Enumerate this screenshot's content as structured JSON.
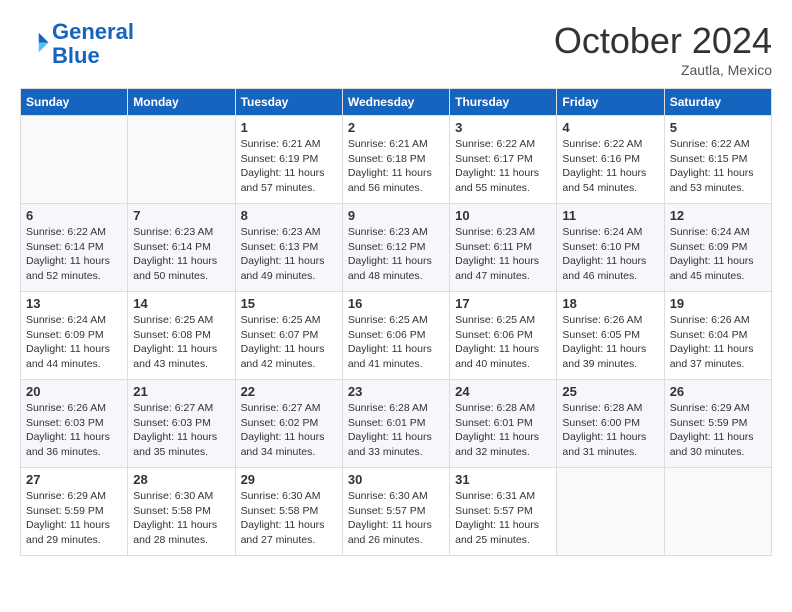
{
  "header": {
    "logo_line1": "General",
    "logo_line2": "Blue",
    "month": "October 2024",
    "location": "Zautla, Mexico"
  },
  "weekdays": [
    "Sunday",
    "Monday",
    "Tuesday",
    "Wednesday",
    "Thursday",
    "Friday",
    "Saturday"
  ],
  "weeks": [
    [
      {
        "day": "",
        "info": ""
      },
      {
        "day": "",
        "info": ""
      },
      {
        "day": "1",
        "info": "Sunrise: 6:21 AM\nSunset: 6:19 PM\nDaylight: 11 hours and 57 minutes."
      },
      {
        "day": "2",
        "info": "Sunrise: 6:21 AM\nSunset: 6:18 PM\nDaylight: 11 hours and 56 minutes."
      },
      {
        "day": "3",
        "info": "Sunrise: 6:22 AM\nSunset: 6:17 PM\nDaylight: 11 hours and 55 minutes."
      },
      {
        "day": "4",
        "info": "Sunrise: 6:22 AM\nSunset: 6:16 PM\nDaylight: 11 hours and 54 minutes."
      },
      {
        "day": "5",
        "info": "Sunrise: 6:22 AM\nSunset: 6:15 PM\nDaylight: 11 hours and 53 minutes."
      }
    ],
    [
      {
        "day": "6",
        "info": "Sunrise: 6:22 AM\nSunset: 6:14 PM\nDaylight: 11 hours and 52 minutes."
      },
      {
        "day": "7",
        "info": "Sunrise: 6:23 AM\nSunset: 6:14 PM\nDaylight: 11 hours and 50 minutes."
      },
      {
        "day": "8",
        "info": "Sunrise: 6:23 AM\nSunset: 6:13 PM\nDaylight: 11 hours and 49 minutes."
      },
      {
        "day": "9",
        "info": "Sunrise: 6:23 AM\nSunset: 6:12 PM\nDaylight: 11 hours and 48 minutes."
      },
      {
        "day": "10",
        "info": "Sunrise: 6:23 AM\nSunset: 6:11 PM\nDaylight: 11 hours and 47 minutes."
      },
      {
        "day": "11",
        "info": "Sunrise: 6:24 AM\nSunset: 6:10 PM\nDaylight: 11 hours and 46 minutes."
      },
      {
        "day": "12",
        "info": "Sunrise: 6:24 AM\nSunset: 6:09 PM\nDaylight: 11 hours and 45 minutes."
      }
    ],
    [
      {
        "day": "13",
        "info": "Sunrise: 6:24 AM\nSunset: 6:09 PM\nDaylight: 11 hours and 44 minutes."
      },
      {
        "day": "14",
        "info": "Sunrise: 6:25 AM\nSunset: 6:08 PM\nDaylight: 11 hours and 43 minutes."
      },
      {
        "day": "15",
        "info": "Sunrise: 6:25 AM\nSunset: 6:07 PM\nDaylight: 11 hours and 42 minutes."
      },
      {
        "day": "16",
        "info": "Sunrise: 6:25 AM\nSunset: 6:06 PM\nDaylight: 11 hours and 41 minutes."
      },
      {
        "day": "17",
        "info": "Sunrise: 6:25 AM\nSunset: 6:06 PM\nDaylight: 11 hours and 40 minutes."
      },
      {
        "day": "18",
        "info": "Sunrise: 6:26 AM\nSunset: 6:05 PM\nDaylight: 11 hours and 39 minutes."
      },
      {
        "day": "19",
        "info": "Sunrise: 6:26 AM\nSunset: 6:04 PM\nDaylight: 11 hours and 37 minutes."
      }
    ],
    [
      {
        "day": "20",
        "info": "Sunrise: 6:26 AM\nSunset: 6:03 PM\nDaylight: 11 hours and 36 minutes."
      },
      {
        "day": "21",
        "info": "Sunrise: 6:27 AM\nSunset: 6:03 PM\nDaylight: 11 hours and 35 minutes."
      },
      {
        "day": "22",
        "info": "Sunrise: 6:27 AM\nSunset: 6:02 PM\nDaylight: 11 hours and 34 minutes."
      },
      {
        "day": "23",
        "info": "Sunrise: 6:28 AM\nSunset: 6:01 PM\nDaylight: 11 hours and 33 minutes."
      },
      {
        "day": "24",
        "info": "Sunrise: 6:28 AM\nSunset: 6:01 PM\nDaylight: 11 hours and 32 minutes."
      },
      {
        "day": "25",
        "info": "Sunrise: 6:28 AM\nSunset: 6:00 PM\nDaylight: 11 hours and 31 minutes."
      },
      {
        "day": "26",
        "info": "Sunrise: 6:29 AM\nSunset: 5:59 PM\nDaylight: 11 hours and 30 minutes."
      }
    ],
    [
      {
        "day": "27",
        "info": "Sunrise: 6:29 AM\nSunset: 5:59 PM\nDaylight: 11 hours and 29 minutes."
      },
      {
        "day": "28",
        "info": "Sunrise: 6:30 AM\nSunset: 5:58 PM\nDaylight: 11 hours and 28 minutes."
      },
      {
        "day": "29",
        "info": "Sunrise: 6:30 AM\nSunset: 5:58 PM\nDaylight: 11 hours and 27 minutes."
      },
      {
        "day": "30",
        "info": "Sunrise: 6:30 AM\nSunset: 5:57 PM\nDaylight: 11 hours and 26 minutes."
      },
      {
        "day": "31",
        "info": "Sunrise: 6:31 AM\nSunset: 5:57 PM\nDaylight: 11 hours and 25 minutes."
      },
      {
        "day": "",
        "info": ""
      },
      {
        "day": "",
        "info": ""
      }
    ]
  ]
}
